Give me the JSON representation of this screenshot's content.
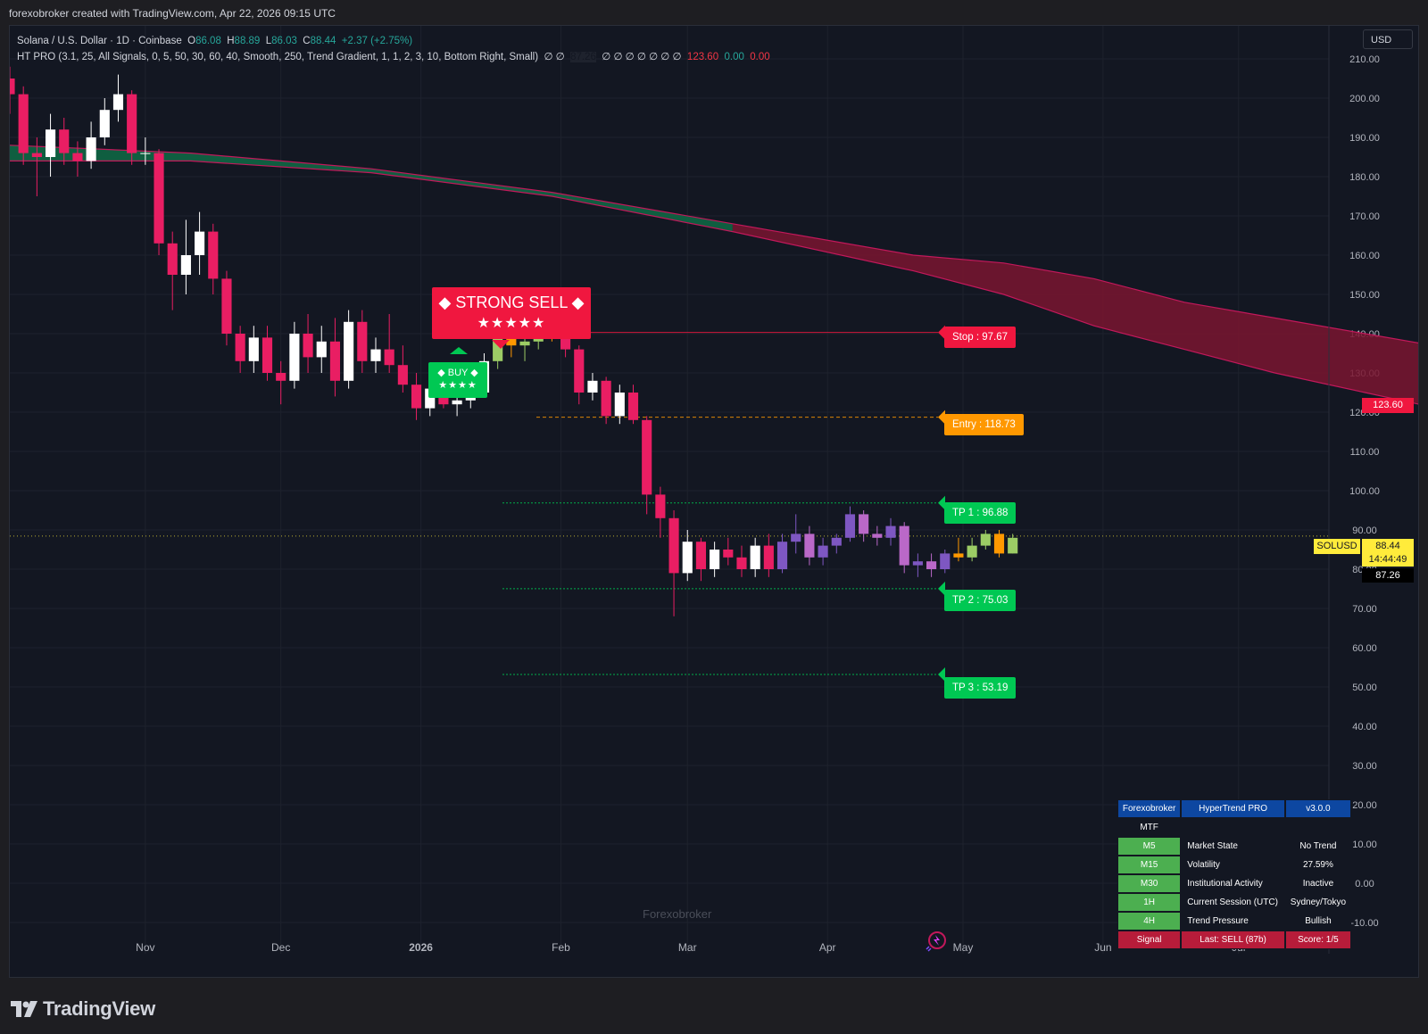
{
  "header": {
    "text": "forexobroker created with TradingView.com, Apr 22, 2026 09:15 UTC"
  },
  "legend": {
    "line1_symbol": "Solana / U.S. Dollar · 1D · Coinbase",
    "open_label": "O",
    "open": "86.08",
    "high_label": "H",
    "high": "88.89",
    "low_label": "L",
    "low": "86.03",
    "close_label": "C",
    "close": "88.44",
    "change": "+2.37 (+2.75%)",
    "line2_params": "HT PRO (3.1, 25, All Signals, 0, 5, 50, 30, 60, 40, Smooth, 250, Trend Gradient, 1, 1, 2, 3, 10, Bottom Right, Small)",
    "line2_vals_a": "∅ ∅",
    "line2_val_dark": "87.26",
    "line2_vals_b": "∅ ∅ ∅ ∅ ∅ ∅ ∅",
    "line2_red": "123.60",
    "line2_green": "0.00",
    "line2_red2": "0.00"
  },
  "currency_button": "USD",
  "watermark": "Forexobroker",
  "footer_brand": "TradingView",
  "signals": {
    "strong_sell": "◆ STRONG SELL ◆",
    "strong_sell_stars": "★★★★★",
    "buy": "◆ BUY ◆",
    "buy_stars": "★★★★"
  },
  "levels": {
    "stop": "Stop : 97.67",
    "entry": "Entry : 118.73",
    "tp1": "TP 1 : 96.88",
    "tp2": "TP 2 : 75.03",
    "tp3": "TP 3 : 53.19"
  },
  "price_tags": {
    "band_top": "123.60",
    "symbol": "SOLUSD",
    "last_price": "88.44",
    "countdown": "14:44:49",
    "line_value": "87.26"
  },
  "colors": {
    "background": "#131722",
    "bull": "#ffffff",
    "bear": "#e91e63",
    "band_bull": "#0f6b45",
    "band_bear": "#7a1530",
    "sell": "#f0173f",
    "buy": "#00c853",
    "entry": "#ff9800",
    "table_header": "#0d47a1",
    "table_tf": "#4caf50",
    "table_signal": "#b71c3a"
  },
  "info_table": {
    "header": [
      "Forexobroker",
      "HyperTrend PRO",
      "v3.0.0"
    ],
    "mtf_label": "MTF",
    "rows": [
      {
        "tf": "M5",
        "label": "Market State",
        "value": "No Trend"
      },
      {
        "tf": "M15",
        "label": "Volatility",
        "value": "27.59%"
      },
      {
        "tf": "M30",
        "label": "Institutional Activity",
        "value": "Inactive"
      },
      {
        "tf": "1H",
        "label": "Current Session (UTC)",
        "value": "Sydney/Tokyo"
      },
      {
        "tf": "4H",
        "label": "Trend Pressure",
        "value": "Bullish"
      }
    ],
    "signal_row": {
      "tf": "Signal",
      "label": "Last: SELL (87b)",
      "value": "Score: 1/5"
    }
  },
  "chart_data": {
    "type": "candlestick",
    "symbol": "SOLUSD",
    "ylim": [
      -10,
      210
    ],
    "y_ticks": [
      210,
      200,
      190,
      180,
      170,
      160,
      150,
      140,
      130,
      120,
      110,
      100,
      90,
      80,
      70,
      60,
      50,
      40,
      30,
      20,
      10,
      0,
      -10
    ],
    "y_tick_labels": [
      "210.00",
      "200.00",
      "190.00",
      "180.00",
      "170.00",
      "160.00",
      "150.00",
      "140.00",
      "130.00",
      "120.00",
      "110.00",
      "100.00",
      "90.00",
      "80.00",
      "70.00",
      "60.00",
      "50.00",
      "40.00",
      "30.00",
      "20.00",
      "10.00",
      "0.00",
      "-10.00"
    ],
    "x_ticks": [
      {
        "label": "Nov",
        "date": "2025-11-01"
      },
      {
        "label": "Dec",
        "date": "2025-12-01"
      },
      {
        "label": "2026",
        "date": "2026-01-01",
        "bold": true
      },
      {
        "label": "Feb",
        "date": "2026-02-01"
      },
      {
        "label": "Mar",
        "date": "2026-03-01"
      },
      {
        "label": "Apr",
        "date": "2026-04-01"
      },
      {
        "label": "May",
        "date": "2026-05-01"
      },
      {
        "label": "Jun",
        "date": "2026-06-01"
      },
      {
        "label": "Jul",
        "date": "2026-07-01"
      }
    ],
    "x_range": [
      "2025-10-02",
      "2026-07-21"
    ],
    "candles": [
      {
        "date": "2025-10-02",
        "o": 205,
        "h": 208,
        "l": 196,
        "c": 201
      },
      {
        "date": "2025-10-05",
        "o": 201,
        "h": 203,
        "l": 183,
        "c": 186
      },
      {
        "date": "2025-10-08",
        "o": 186,
        "h": 190,
        "l": 175,
        "c": 185
      },
      {
        "date": "2025-10-11",
        "o": 185,
        "h": 196,
        "l": 180,
        "c": 192
      },
      {
        "date": "2025-10-14",
        "o": 192,
        "h": 195,
        "l": 183,
        "c": 186
      },
      {
        "date": "2025-10-17",
        "o": 186,
        "h": 189,
        "l": 180,
        "c": 184
      },
      {
        "date": "2025-10-20",
        "o": 184,
        "h": 194,
        "l": 182,
        "c": 190
      },
      {
        "date": "2025-10-23",
        "o": 190,
        "h": 200,
        "l": 188,
        "c": 197
      },
      {
        "date": "2025-10-26",
        "o": 197,
        "h": 206,
        "l": 194,
        "c": 201
      },
      {
        "date": "2025-10-29",
        "o": 201,
        "h": 202,
        "l": 183,
        "c": 186
      },
      {
        "date": "2025-11-01",
        "o": 186,
        "h": 190,
        "l": 183,
        "c": 186
      },
      {
        "date": "2025-11-04",
        "o": 186,
        "h": 187,
        "l": 160,
        "c": 163
      },
      {
        "date": "2025-11-07",
        "o": 163,
        "h": 166,
        "l": 146,
        "c": 155
      },
      {
        "date": "2025-11-10",
        "o": 155,
        "h": 169,
        "l": 150,
        "c": 160
      },
      {
        "date": "2025-11-13",
        "o": 160,
        "h": 171,
        "l": 155,
        "c": 166
      },
      {
        "date": "2025-11-16",
        "o": 166,
        "h": 168,
        "l": 150,
        "c": 154
      },
      {
        "date": "2025-11-19",
        "o": 154,
        "h": 156,
        "l": 137,
        "c": 140
      },
      {
        "date": "2025-11-22",
        "o": 140,
        "h": 142,
        "l": 130,
        "c": 133
      },
      {
        "date": "2025-11-25",
        "o": 133,
        "h": 142,
        "l": 130,
        "c": 139
      },
      {
        "date": "2025-11-28",
        "o": 139,
        "h": 142,
        "l": 128,
        "c": 130
      },
      {
        "date": "2025-12-01",
        "o": 130,
        "h": 133,
        "l": 122,
        "c": 128
      },
      {
        "date": "2025-12-04",
        "o": 128,
        "h": 143,
        "l": 126,
        "c": 140
      },
      {
        "date": "2025-12-07",
        "o": 140,
        "h": 145,
        "l": 130,
        "c": 134
      },
      {
        "date": "2025-12-10",
        "o": 134,
        "h": 142,
        "l": 130,
        "c": 138
      },
      {
        "date": "2025-12-13",
        "o": 138,
        "h": 144,
        "l": 124,
        "c": 128
      },
      {
        "date": "2025-12-16",
        "o": 128,
        "h": 146,
        "l": 126,
        "c": 143
      },
      {
        "date": "2025-12-19",
        "o": 143,
        "h": 146,
        "l": 130,
        "c": 133
      },
      {
        "date": "2025-12-22",
        "o": 133,
        "h": 139,
        "l": 130,
        "c": 136
      },
      {
        "date": "2025-12-25",
        "o": 136,
        "h": 145,
        "l": 130,
        "c": 132
      },
      {
        "date": "2025-12-28",
        "o": 132,
        "h": 137,
        "l": 125,
        "c": 127
      },
      {
        "date": "2025-12-31",
        "o": 127,
        "h": 130,
        "l": 118,
        "c": 121
      },
      {
        "date": "2026-01-03",
        "o": 121,
        "h": 127,
        "l": 119,
        "c": 126
      },
      {
        "date": "2026-01-06",
        "o": 126,
        "h": 128,
        "l": 121,
        "c": 122
      },
      {
        "date": "2026-01-09",
        "o": 122,
        "h": 124,
        "l": 119,
        "c": 123
      },
      {
        "date": "2026-01-12",
        "o": 123,
        "h": 126,
        "l": 121,
        "c": 125
      },
      {
        "date": "2026-01-15",
        "o": 125,
        "h": 135,
        "l": 124,
        "c": 133
      },
      {
        "date": "2026-01-18",
        "o": 133,
        "h": 142,
        "l": 131,
        "c": 139
      },
      {
        "date": "2026-01-21",
        "o": 139,
        "h": 141,
        "l": 134,
        "c": 137
      },
      {
        "date": "2026-01-24",
        "o": 137,
        "h": 140,
        "l": 133,
        "c": 138
      },
      {
        "date": "2026-01-27",
        "o": 138,
        "h": 147,
        "l": 136,
        "c": 145
      },
      {
        "date": "2026-01-30",
        "o": 145,
        "h": 147,
        "l": 138,
        "c": 141
      },
      {
        "date": "2026-02-02",
        "o": 141,
        "h": 146,
        "l": 134,
        "c": 136
      },
      {
        "date": "2026-02-05",
        "o": 136,
        "h": 137,
        "l": 122,
        "c": 125
      },
      {
        "date": "2026-02-08",
        "o": 125,
        "h": 130,
        "l": 123,
        "c": 128
      },
      {
        "date": "2026-02-11",
        "o": 128,
        "h": 129,
        "l": 117,
        "c": 119
      },
      {
        "date": "2026-02-14",
        "o": 119,
        "h": 127,
        "l": 117,
        "c": 125
      },
      {
        "date": "2026-02-17",
        "o": 125,
        "h": 127,
        "l": 117,
        "c": 118
      },
      {
        "date": "2026-02-20",
        "o": 118,
        "h": 119,
        "l": 94,
        "c": 99
      },
      {
        "date": "2026-02-23",
        "o": 99,
        "h": 101,
        "l": 88,
        "c": 93
      },
      {
        "date": "2026-02-26",
        "o": 93,
        "h": 95,
        "l": 68,
        "c": 79
      },
      {
        "date": "2026-03-01",
        "o": 79,
        "h": 90,
        "l": 77,
        "c": 87
      },
      {
        "date": "2026-03-04",
        "o": 87,
        "h": 88,
        "l": 77,
        "c": 80
      },
      {
        "date": "2026-03-07",
        "o": 80,
        "h": 87,
        "l": 78,
        "c": 85
      },
      {
        "date": "2026-03-10",
        "o": 85,
        "h": 88,
        "l": 81,
        "c": 83
      },
      {
        "date": "2026-03-13",
        "o": 83,
        "h": 86,
        "l": 78,
        "c": 80
      },
      {
        "date": "2026-03-16",
        "o": 80,
        "h": 88,
        "l": 78,
        "c": 86
      },
      {
        "date": "2026-03-19",
        "o": 86,
        "h": 89,
        "l": 78,
        "c": 80
      },
      {
        "date": "2026-03-22",
        "o": 80,
        "h": 89,
        "l": 79,
        "c": 87
      },
      {
        "date": "2026-03-25",
        "o": 87,
        "h": 94,
        "l": 84,
        "c": 89
      },
      {
        "date": "2026-03-28",
        "o": 89,
        "h": 91,
        "l": 81,
        "c": 83
      },
      {
        "date": "2026-03-31",
        "o": 83,
        "h": 88,
        "l": 81,
        "c": 86
      },
      {
        "date": "2026-04-03",
        "o": 86,
        "h": 89,
        "l": 84,
        "c": 88
      },
      {
        "date": "2026-04-06",
        "o": 88,
        "h": 96,
        "l": 87,
        "c": 94
      },
      {
        "date": "2026-04-09",
        "o": 94,
        "h": 95,
        "l": 87,
        "c": 89
      },
      {
        "date": "2026-04-12",
        "o": 89,
        "h": 91,
        "l": 86,
        "c": 88
      },
      {
        "date": "2026-04-15",
        "o": 88,
        "h": 93,
        "l": 86,
        "c": 91
      },
      {
        "date": "2026-04-18",
        "o": 91,
        "h": 92,
        "l": 79,
        "c": 81
      },
      {
        "date": "2026-04-21",
        "o": 81,
        "h": 84,
        "l": 78,
        "c": 82
      },
      {
        "date": "2026-04-24",
        "o": 82,
        "h": 84,
        "l": 78,
        "c": 80
      },
      {
        "date": "2026-04-27",
        "o": 80,
        "h": 85,
        "l": 79,
        "c": 84
      },
      {
        "date": "2026-04-30",
        "o": 84,
        "h": 88,
        "l": 82,
        "c": 83
      },
      {
        "date": "2026-05-03",
        "o": 83,
        "h": 88,
        "l": 82,
        "c": 86
      },
      {
        "date": "2026-05-06",
        "o": 86,
        "h": 90,
        "l": 85,
        "c": 89
      },
      {
        "date": "2026-05-09",
        "o": 89,
        "h": 90,
        "l": 83,
        "c": 84
      },
      {
        "date": "2026-05-12",
        "o": 84,
        "h": 89,
        "l": 84,
        "c": 88
      }
    ],
    "band": {
      "type": "area",
      "upper": [
        [
          0,
          188
        ],
        [
          40,
          186
        ],
        [
          80,
          182
        ],
        [
          120,
          176
        ],
        [
          160,
          168
        ],
        [
          200,
          160
        ],
        [
          220,
          158
        ],
        [
          240,
          154
        ],
        [
          260,
          148
        ],
        [
          280,
          144
        ],
        [
          300,
          140
        ],
        [
          320,
          136
        ],
        [
          340,
          133
        ],
        [
          353,
          131
        ],
        [
          362,
          123.6
        ]
      ],
      "lower": [
        [
          0,
          184
        ],
        [
          40,
          184
        ],
        [
          80,
          181
        ],
        [
          120,
          175
        ],
        [
          160,
          166
        ],
        [
          200,
          156
        ],
        [
          220,
          150
        ],
        [
          240,
          142
        ],
        [
          260,
          136
        ],
        [
          280,
          130
        ],
        [
          300,
          125
        ],
        [
          320,
          120
        ],
        [
          340,
          116
        ],
        [
          353,
          113
        ],
        [
          362,
          108
        ]
      ],
      "bull_until_index": 4
    },
    "levels": [
      {
        "name": "Stop",
        "value": 140.3
      },
      {
        "name": "Entry",
        "value": 118.73
      },
      {
        "name": "TP 1",
        "value": 96.88
      },
      {
        "name": "TP 2",
        "value": 75.03
      },
      {
        "name": "TP 3",
        "value": 53.19
      }
    ],
    "last_price": 88.44
  }
}
